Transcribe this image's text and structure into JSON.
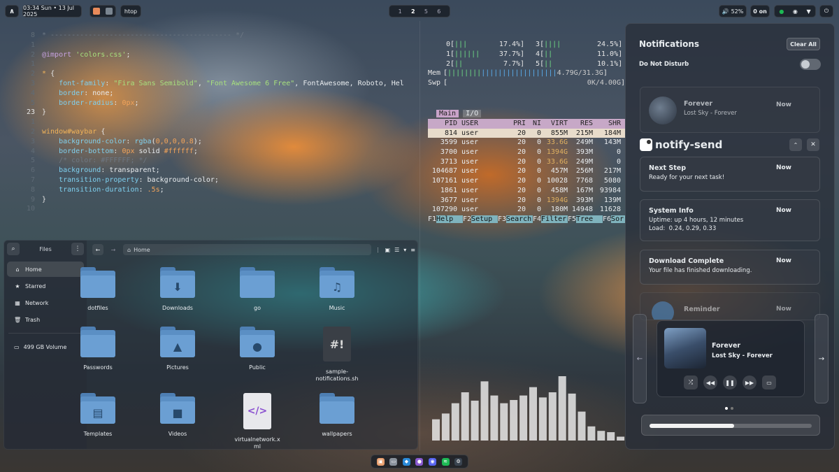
{
  "topbar": {
    "clock": "03:34 Sun • 13 Jul 2025",
    "active_app": "htop",
    "workspaces": [
      "1",
      "2",
      "5",
      "6"
    ],
    "active_workspace": "2",
    "volume": "52%",
    "notif_count": "0 on"
  },
  "editor": {
    "lines": [
      {
        "n": "8",
        "html": "<span class='c-com'>* ------------------------------------------- */</span>"
      },
      {
        "n": "1",
        "html": ""
      },
      {
        "n": "2",
        "html": "<span class='c-at'>@import</span> <span class='c-str'>'colors.css'</span><span class='c-punct'>;</span>"
      },
      {
        "n": "1",
        "html": ""
      },
      {
        "n": "2",
        "html": "<span class='c-sel'>*</span> <span class='c-punct'>{</span>"
      },
      {
        "n": "3",
        "html": "    <span class='c-prop'>font-family</span><span class='c-punct'>:</span> <span class='c-str'>\"Fira Sans Semibold\"</span>, <span class='c-str'>\"Font Awesome 6 Free\"</span>, FontAwesome, Roboto, Hel"
      },
      {
        "n": "4",
        "html": "    <span class='c-prop'>border</span><span class='c-punct'>:</span> none;"
      },
      {
        "n": "5",
        "html": "    <span class='c-prop'>border-radius</span><span class='c-punct'>:</span> <span class='c-num'>0px</span>;"
      },
      {
        "n": "23",
        "html": "<span class='c-punct'>}</span>"
      },
      {
        "n": "1",
        "html": ""
      },
      {
        "n": "2",
        "html": "<span class='c-sel'>window#waybar</span> <span class='c-punct'>{</span>"
      },
      {
        "n": "3",
        "html": "    <span class='c-prop'>background-color</span><span class='c-punct'>:</span> <span class='c-prop'>rgba</span>(<span class='c-num'>0,0,0,0.8</span>);"
      },
      {
        "n": "4",
        "html": "    <span class='c-prop'>border-bottom</span><span class='c-punct'>:</span> <span class='c-num'>0px</span> solid <span class='c-num'>#ffffff</span>;"
      },
      {
        "n": "5",
        "html": "    <span class='c-com'>/* color: #FFFFFF; */</span>"
      },
      {
        "n": "6",
        "html": "    <span class='c-prop'>background</span><span class='c-punct'>:</span> transparent;"
      },
      {
        "n": "7",
        "html": "    <span class='c-prop'>transition-property</span><span class='c-punct'>:</span> background-color;"
      },
      {
        "n": "8",
        "html": "    <span class='c-prop'>transition-duration</span><span class='c-punct'>:</span> <span class='c-num'>.5s</span>;"
      },
      {
        "n": "9",
        "html": "<span class='c-punct'>}</span>"
      },
      {
        "n": "10",
        "html": ""
      }
    ]
  },
  "htop": {
    "meters": [
      {
        "l": "0",
        "lb": "|||",
        "lv": "17.4%",
        "r": "3",
        "rb": "||||",
        "rv": "24.5%"
      },
      {
        "l": "1",
        "lb": "||||||",
        "lv": "37.7%",
        "r": "4",
        "rb": "||",
        "rv": "11.0%"
      },
      {
        "l": "2",
        "lb": "||",
        "lv": "7.7%",
        "r": "5",
        "rb": "||",
        "rv": "10.1%"
      }
    ],
    "mem_label": "Mem",
    "mem_val": "4.79G/31.3G",
    "swp_label": "Swp",
    "swp_val": "0K/4.00G",
    "tabs": [
      "Main",
      "I/O"
    ],
    "headers": [
      "PID",
      "USER",
      "PRI",
      "NI",
      "VIRT",
      "RES",
      "SHR"
    ],
    "rows": [
      [
        "814",
        "user",
        "20",
        "0",
        "855M",
        "215M",
        "184M"
      ],
      [
        "3599",
        "user",
        "20",
        "0",
        "33.6G",
        "249M",
        "143M"
      ],
      [
        "3700",
        "user",
        "20",
        "0",
        "1394G",
        "393M",
        "0"
      ],
      [
        "3713",
        "user",
        "20",
        "0",
        "33.6G",
        "249M",
        "0"
      ],
      [
        "104687",
        "user",
        "20",
        "0",
        "457M",
        "256M",
        "217M"
      ],
      [
        "107161",
        "user",
        "20",
        "0",
        "10028",
        "7768",
        "5080"
      ],
      [
        "1861",
        "user",
        "20",
        "0",
        "458M",
        "167M",
        "93984"
      ],
      [
        "3677",
        "user",
        "20",
        "0",
        "1394G",
        "393M",
        "139M"
      ],
      [
        "107290",
        "user",
        "20",
        "0",
        "180M",
        "14948",
        "11628"
      ]
    ],
    "fkeys": [
      [
        "F1",
        "Help"
      ],
      [
        "F2",
        "Setup"
      ],
      [
        "F3",
        "Search"
      ],
      [
        "F4",
        "Filter"
      ],
      [
        "F5",
        "Tree"
      ],
      [
        "F6",
        "Sor"
      ]
    ]
  },
  "files": {
    "title": "Files",
    "path": "Home",
    "sidebar": [
      {
        "label": "Home",
        "icon": "home-icon"
      },
      {
        "label": "Starred",
        "icon": "star-icon"
      },
      {
        "label": "Network",
        "icon": "network-icon"
      },
      {
        "label": "Trash",
        "icon": "trash-icon"
      }
    ],
    "volume": "499 GB Volume",
    "items": [
      {
        "label": "dotfiles",
        "kind": "folder",
        "glyph": ""
      },
      {
        "label": "Downloads",
        "kind": "folder",
        "glyph": "⬇"
      },
      {
        "label": "go",
        "kind": "folder",
        "glyph": ""
      },
      {
        "label": "Music",
        "kind": "folder",
        "glyph": "♫"
      },
      {
        "label": "Passwords",
        "kind": "folder",
        "glyph": ""
      },
      {
        "label": "Pictures",
        "kind": "folder",
        "glyph": "▲"
      },
      {
        "label": "Public",
        "kind": "folder",
        "glyph": "●"
      },
      {
        "label": "sample-notifications.sh",
        "kind": "script",
        "glyph": "#!"
      },
      {
        "label": "Templates",
        "kind": "folder",
        "glyph": "▤"
      },
      {
        "label": "Videos",
        "kind": "folder",
        "glyph": "■"
      },
      {
        "label": "virtualnetwork.xml",
        "kind": "xml",
        "glyph": "</>"
      },
      {
        "label": "wallpapers",
        "kind": "folder",
        "glyph": ""
      }
    ]
  },
  "visualizer": {
    "values": [
      0.33,
      0.42,
      0.58,
      0.75,
      0.62,
      0.92,
      0.7,
      0.58,
      0.63,
      0.7,
      0.83,
      0.67,
      0.75,
      1.0,
      0.73,
      0.45,
      0.22,
      0.15,
      0.13,
      0.06
    ]
  },
  "notifications": {
    "title": "Notifications",
    "clear_all": "Clear All",
    "dnd_label": "Do Not Disturb",
    "group_app": "notify-send",
    "items": [
      {
        "title": "Forever",
        "body": "Lost Sky - Forever",
        "time": "Now"
      },
      {
        "title": "Next Step",
        "body": "Ready for your next task!",
        "time": "Now"
      },
      {
        "title": "System Info",
        "body": "Uptime: up 4 hours, 12 minutes",
        "body2": "Load:  0.24, 0.29, 0.33",
        "time": "Now"
      },
      {
        "title": "Download Complete",
        "body": "Your file has finished downloading.",
        "time": "Now"
      },
      {
        "title": "Reminder",
        "body": "",
        "time": "Now"
      }
    ],
    "player": {
      "title": "Forever",
      "artist": "Lost Sky - Forever",
      "progress": 0.52
    }
  },
  "dock": {
    "apps": [
      "files-icon",
      "terminal-icon",
      "vscode-icon",
      "browser-icon",
      "discord-icon",
      "spotify-icon",
      "steam-icon"
    ]
  },
  "colors": {
    "accent": "#5b8fc4",
    "htop_green": "#6fdc84",
    "htop_blue": "#5ab0f0",
    "visualizer": "#e8e8e8"
  }
}
